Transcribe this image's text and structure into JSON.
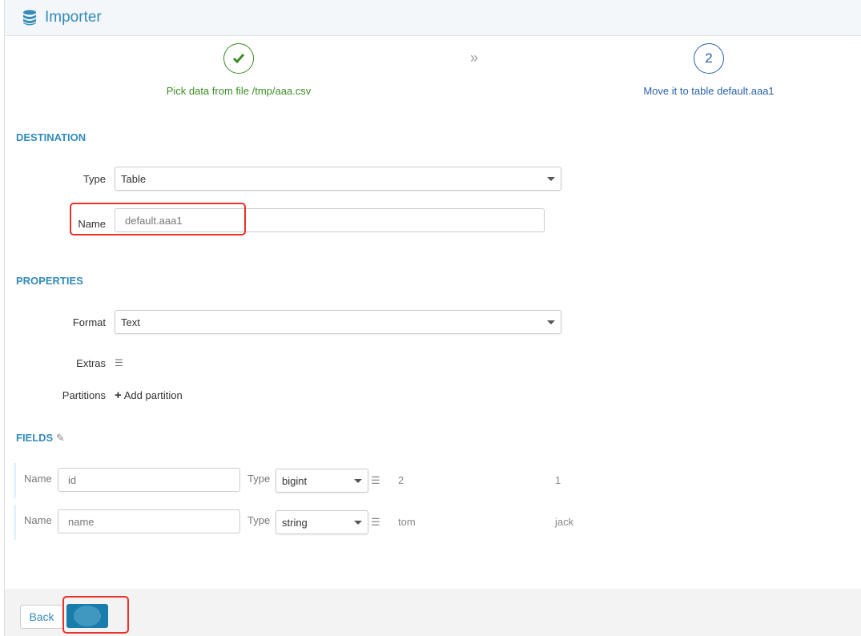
{
  "header": {
    "title": "Importer",
    "icon": "database-icon"
  },
  "steps": [
    {
      "label": "Pick data from file /tmp/aaa.csv",
      "status": "done"
    },
    {
      "number": "2",
      "label": "Move it to table default.aaa1",
      "status": "current"
    }
  ],
  "destination": {
    "heading": "DESTINATION",
    "type_label": "Type",
    "type_value": "Table",
    "name_label": "Name",
    "name_value": "default.aaa1"
  },
  "properties": {
    "heading": "PROPERTIES",
    "format_label": "Format",
    "format_value": "Text",
    "extras_label": "Extras",
    "partitions_label": "Partitions",
    "add_partition": "Add partition"
  },
  "fields": {
    "heading": "FIELDS",
    "rows": [
      {
        "name_label": "Name",
        "name": "id",
        "type_label": "Type",
        "type": "bigint",
        "sample1": "2",
        "sample2": "1"
      },
      {
        "name_label": "Name",
        "name": "name",
        "type_label": "Type",
        "type": "string",
        "sample1": "tom",
        "sample2": "jack"
      }
    ]
  },
  "footer": {
    "back": "Back"
  },
  "colors": {
    "accent": "#338bb8",
    "success": "#3c8c24",
    "highlight": "#e8322a"
  }
}
